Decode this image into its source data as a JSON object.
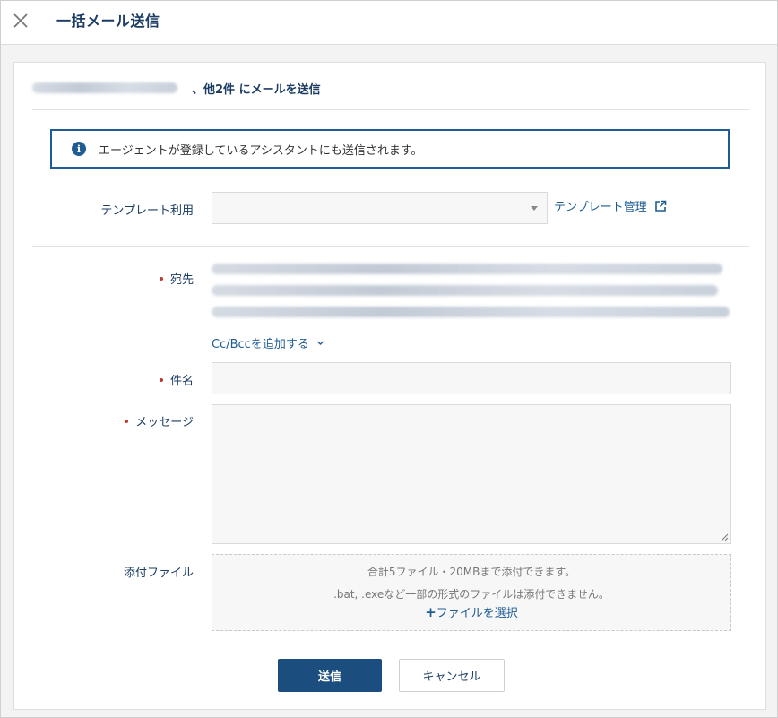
{
  "header": {
    "title": "一括メール送信",
    "close_icon": "close-icon"
  },
  "recipients_summary": {
    "suffix": "、他2件 にメールを送信"
  },
  "notice": {
    "icon": "info-icon",
    "text": "エージェントが登録しているアシスタントにも送信されます。"
  },
  "template": {
    "label": "テンプレート利用",
    "value": "",
    "manage_link": "テンプレート管理",
    "manage_icon": "external-link-icon"
  },
  "to": {
    "label": "宛先",
    "required": true
  },
  "cc_bcc": {
    "label": "Cc/Bccを追加する",
    "icon": "chevron-down-icon"
  },
  "subject": {
    "label": "件名",
    "required": true,
    "value": ""
  },
  "message": {
    "label": "メッセージ",
    "required": true,
    "value": ""
  },
  "attachment": {
    "label": "添付ファイル",
    "note1": "合計5ファイル・20MBまで添付できます。",
    "note2": ".bat, .exeなど一部の形式のファイルは添付できません。",
    "select_plus": "+",
    "select_label": "ファイルを選択"
  },
  "buttons": {
    "send": "送信",
    "cancel": "キャンセル"
  },
  "colors": {
    "brand": "#1b4d7e",
    "link": "#1f5c93",
    "required": "#c0392b"
  }
}
